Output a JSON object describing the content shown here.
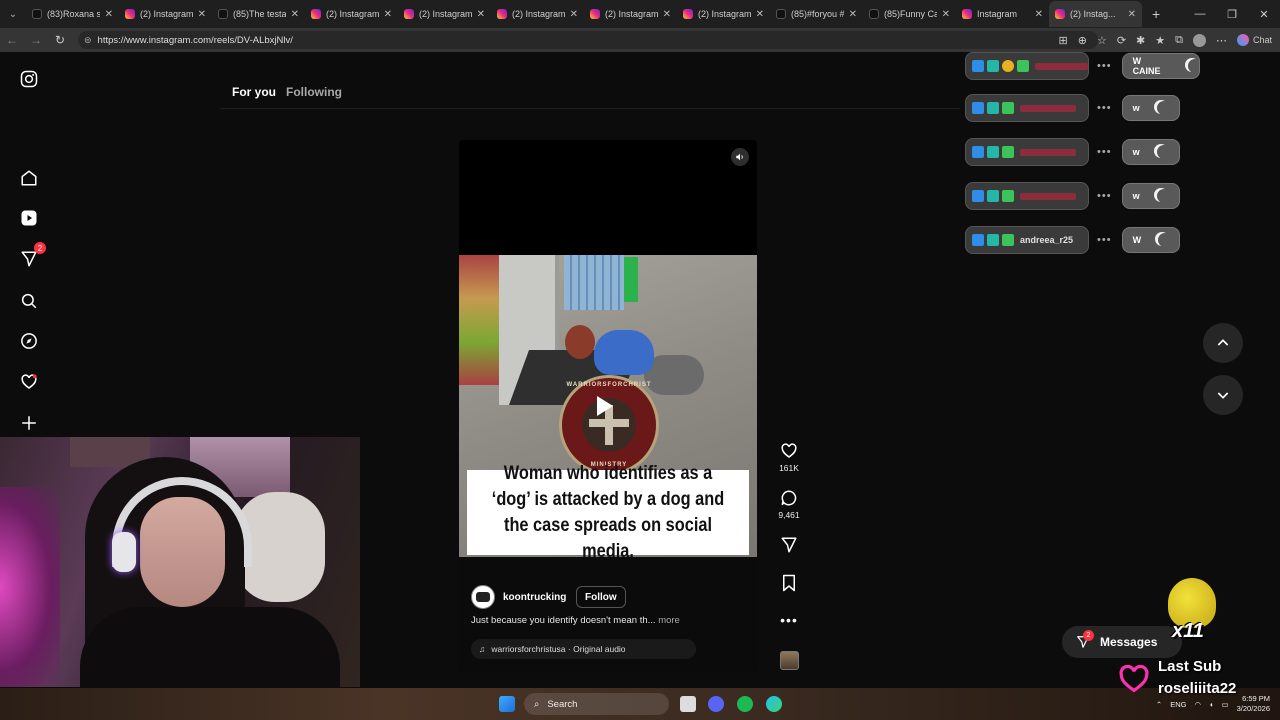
{
  "browser": {
    "tabs": [
      {
        "label": "(83)Roxana se ...",
        "kind": "tt"
      },
      {
        "label": "(2) Instagram",
        "kind": "ig"
      },
      {
        "label": "(85)The testam...",
        "kind": "tt"
      },
      {
        "label": "(2) Instagram",
        "kind": "ig"
      },
      {
        "label": "(2) Instagram",
        "kind": "ig"
      },
      {
        "label": "(2) Instagram",
        "kind": "ig"
      },
      {
        "label": "(2) Instagram",
        "kind": "ig"
      },
      {
        "label": "(2) Instagram",
        "kind": "ig"
      },
      {
        "label": "(85)#foryou #...",
        "kind": "tt"
      },
      {
        "label": "(85)Funny Cat ...",
        "kind": "tt"
      },
      {
        "label": "Instagram",
        "kind": "ig"
      },
      {
        "label": "(2) Instag...",
        "kind": "ig",
        "active": true
      }
    ],
    "url": "https://www.instagram.com/reels/DV-ALbxjNlv/",
    "chat_label": "Chat"
  },
  "instagram": {
    "feed_tabs": {
      "for_you": "For you",
      "following": "Following"
    },
    "notifications_badge": "2",
    "reel": {
      "caption_overlay": "Woman who identifies as a ‘dog’ is attacked by a dog and the case spreads on social media.",
      "emblem_top": "WARRIORSFORCHRIST",
      "emblem_bottom": "MINISTRY",
      "author": "koontrucking",
      "follow_label": "Follow",
      "description": "Just because you identify doesn't mean th...",
      "more_label": "more",
      "audio": "warriorsforchristusa · Original audio",
      "likes": "161K",
      "comments": "9,461"
    },
    "messages_label": "Messages",
    "messages_badge": "2"
  },
  "stream_overlay": {
    "chat": [
      {
        "name": "",
        "message": "W CAINE",
        "name_color": "#d02040"
      },
      {
        "name": "",
        "message": "w",
        "name_color": "#d02040"
      },
      {
        "name": "",
        "message": "w",
        "name_color": "#d02040"
      },
      {
        "name": "",
        "message": "w",
        "name_color": "#d02040"
      },
      {
        "name": "andreea_r25",
        "message": "W",
        "name_color": "#e0e0e0"
      }
    ],
    "multiplier": "x11",
    "last_sub_label": "Last Sub",
    "last_sub_name": "roseliiita22"
  },
  "taskbar": {
    "search_label": "Search",
    "language": "ENG",
    "time": "6:59 PM",
    "date": "3/20/2026"
  },
  "colors": {
    "accent_red": "#ff3040",
    "chat_name_red": "#d02040"
  }
}
